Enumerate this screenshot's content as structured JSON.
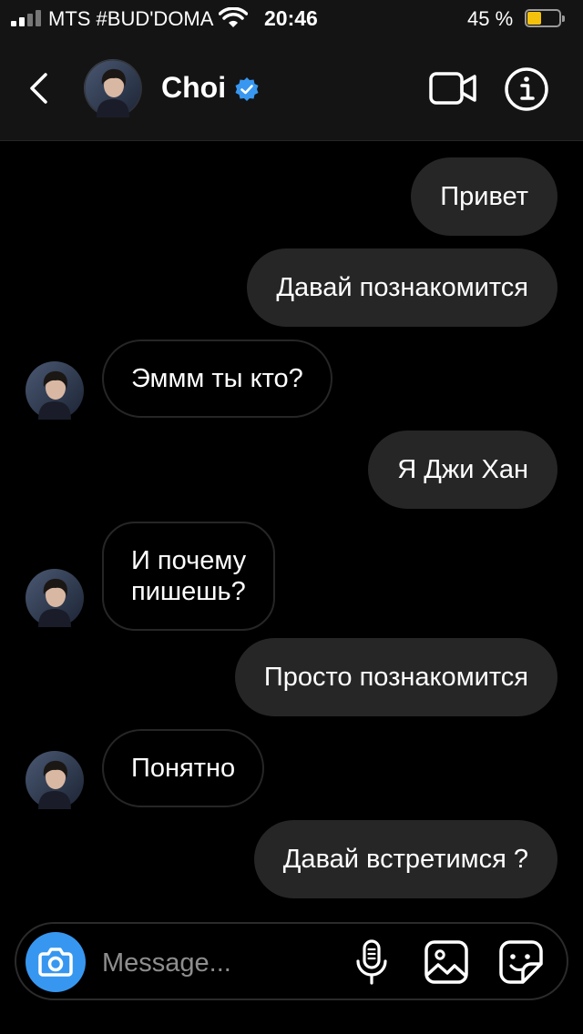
{
  "status_bar": {
    "carrier": "MTS #BUD'DOMA",
    "time": "20:46",
    "battery": "45 %",
    "battery_level": 0.45
  },
  "header": {
    "name": "Choi",
    "verified": true
  },
  "messages": [
    {
      "direction": "sent",
      "text": "Привет"
    },
    {
      "direction": "sent",
      "text": "Давай познакомится"
    },
    {
      "direction": "received",
      "text": "Эммм ты кто?"
    },
    {
      "direction": "sent",
      "text": "Я Джи Хан"
    },
    {
      "direction": "received",
      "lines": [
        "И почему",
        "пишешь?"
      ]
    },
    {
      "direction": "sent",
      "text": "Просто познакомится"
    },
    {
      "direction": "received",
      "text": "Понятно"
    },
    {
      "direction": "sent",
      "text": "Давай встретимся ?"
    }
  ],
  "composer": {
    "placeholder": "Message..."
  },
  "colors": {
    "background": "#000000",
    "bar": "#141414",
    "sent_bubble": "#262626",
    "received_border": "#262626",
    "accent": "#3797f0",
    "battery": "#f4c20d"
  },
  "icons": [
    "back-icon",
    "verified-icon",
    "video-camera-icon",
    "info-icon",
    "camera-icon",
    "microphone-icon",
    "gallery-icon",
    "sticker-icon"
  ]
}
